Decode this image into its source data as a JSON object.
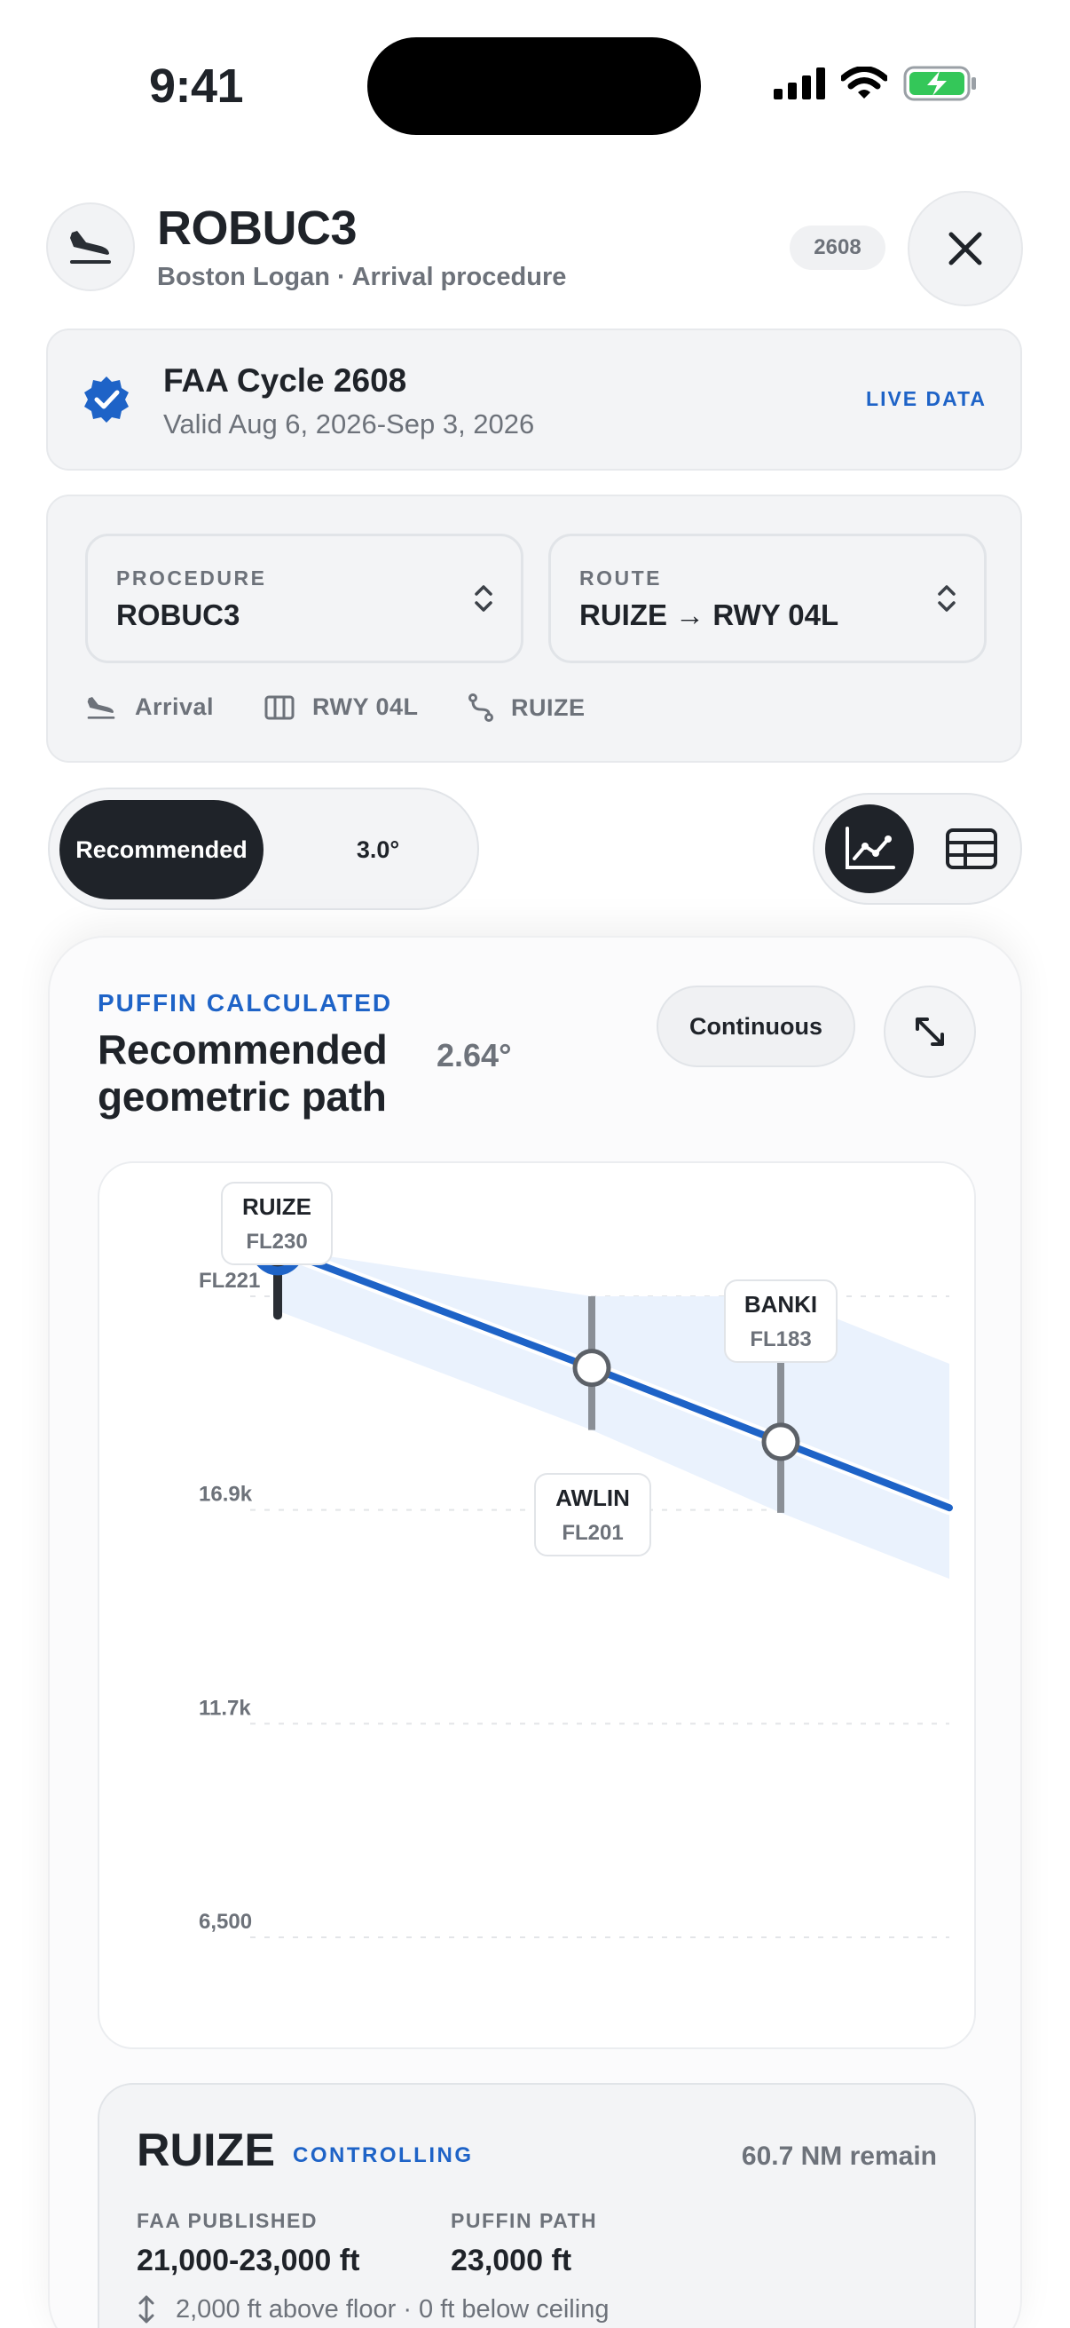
{
  "status_bar": {
    "time": "9:41"
  },
  "header": {
    "title": "ROBUC3",
    "subtitle": "Boston Logan · Arrival procedure",
    "badge": "2608"
  },
  "cycle": {
    "title": "FAA Cycle 2608",
    "validity": "Valid Aug 6, 2026-Sep 3, 2026",
    "status": "LIVE DATA"
  },
  "selectors": {
    "procedure": {
      "label": "PROCEDURE",
      "value": "ROBUC3"
    },
    "route": {
      "label": "ROUTE",
      "value": "RUIZE → RWY 04L"
    }
  },
  "meta": {
    "type": "Arrival",
    "runway": "RWY 04L",
    "transition": "RUIZE"
  },
  "mode_toggle": {
    "selected": "Recommended",
    "alternate": "3.0°"
  },
  "view_toggle": {
    "selected": "chart-icon",
    "alternate": "table-icon"
  },
  "path_card": {
    "eyebrow": "PUFFIN CALCULATED",
    "title": "Recommended geometric path",
    "angle": "2.64°",
    "mode_button": "Continuous"
  },
  "chart_data": {
    "type": "line",
    "y_ticks": [
      {
        "label": "FL221",
        "value": 22100
      },
      {
        "label": "16.9k",
        "value": 16900
      },
      {
        "label": "11.7k",
        "value": 11700
      },
      {
        "label": "6,500",
        "value": 6500
      }
    ],
    "ylim": [
      6500,
      22100
    ],
    "series": [
      {
        "values": [
          23000,
          20100,
          18300
        ]
      }
    ],
    "waypoints": [
      {
        "name": "RUIZE",
        "level": "FL230",
        "altitude": 23000,
        "floor": 21000,
        "ceiling": 23000
      },
      {
        "name": "AWLIN",
        "level": "FL201",
        "altitude": 20100
      },
      {
        "name": "BANKI",
        "level": "FL183",
        "altitude": 18300
      }
    ],
    "grid": true,
    "colors": {
      "path": "#1e63c7",
      "band": "#eaf2fd",
      "constraint": "#8a8f96"
    }
  },
  "waypoint_detail": {
    "name": "RUIZE",
    "tag": "CONTROLLING",
    "remaining": "60.7 NM remain",
    "published_label": "FAA PUBLISHED",
    "published_value": "21,000-23,000 ft",
    "path_label": "PUFFIN PATH",
    "path_value": "23,000 ft",
    "margin": "2,000 ft above floor · 0 ft below ceiling"
  }
}
